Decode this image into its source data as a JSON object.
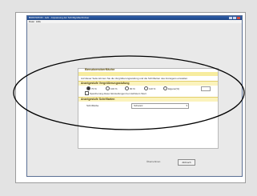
{
  "window": {
    "title": "BIOSTATION - EAI - Anpassung der Schriftgröße/Ordner",
    "menu": [
      "Datei",
      "Hilfe"
    ]
  },
  "panel": {
    "title": "Benutzeroberfläche",
    "description": "Auf dieser Seite können Sie die Vergrößerungsstufung und die Schriftarten des Anzeigens einstellen.",
    "section_zoom": "Anzeigestufe Vergrößerungsstufung",
    "zoom_options": [
      "70 %",
      "100 %",
      "90 %",
      "110 %",
      "Eigene(%)"
    ],
    "checkbox_label": "Speicherung dieser Einstellungen bei nächstem Start",
    "section_font": "Anzeigestufe Schriftarten",
    "font_label": "Schriftfarbe",
    "font_value": "Schwarz"
  },
  "footer": {
    "apply_text": "Übernehmen",
    "cancel_label": "Abbruch"
  },
  "colors": {
    "titlebar": "#2f5fa8",
    "banner": "#f7ec9e",
    "highlight": "#000000"
  }
}
